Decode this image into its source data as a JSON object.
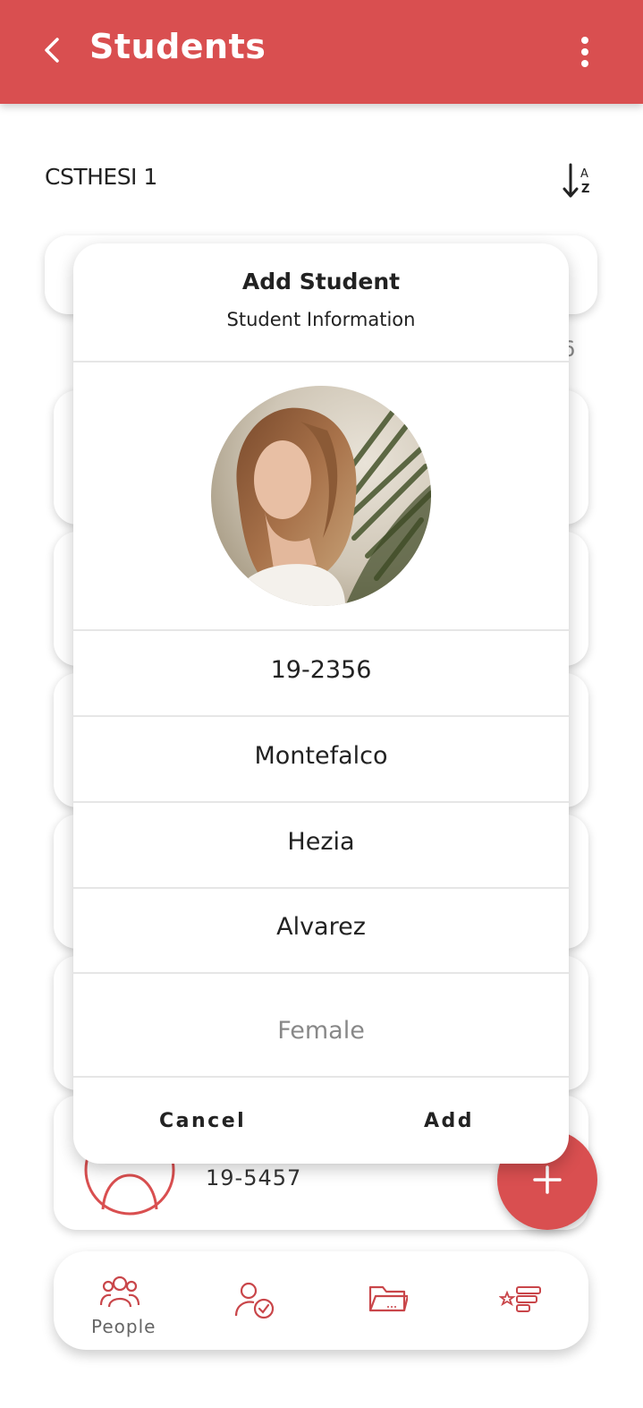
{
  "header": {
    "title": "Students",
    "back_icon": "chevron-left-icon",
    "menu_icon": "more-vertical-icon",
    "background": "#d94f50"
  },
  "section": {
    "title": "CSTHESI 1",
    "sort_icon": "sort-alpha-icon"
  },
  "background_list": {
    "partial_text": "6",
    "visible_student_id": "19-5457"
  },
  "dialog": {
    "title": "Add Student",
    "subtitle": "Student Information",
    "fields": {
      "student_id": "19-2356",
      "last_name": "Montefalco",
      "first_name": "Hezia",
      "middle_name": "Alvarez",
      "gender_placeholder": "Female"
    },
    "cancel_label": "Cancel",
    "add_label": "Add"
  },
  "fab": {
    "icon": "plus-icon"
  },
  "bottom_nav": {
    "items": [
      {
        "label": "People",
        "icon": "people-icon"
      },
      {
        "label": "",
        "icon": "user-check-icon"
      },
      {
        "label": "",
        "icon": "folder-icon"
      },
      {
        "label": "",
        "icon": "ranking-list-icon"
      }
    ]
  },
  "colors": {
    "accent": "#d94f50"
  }
}
